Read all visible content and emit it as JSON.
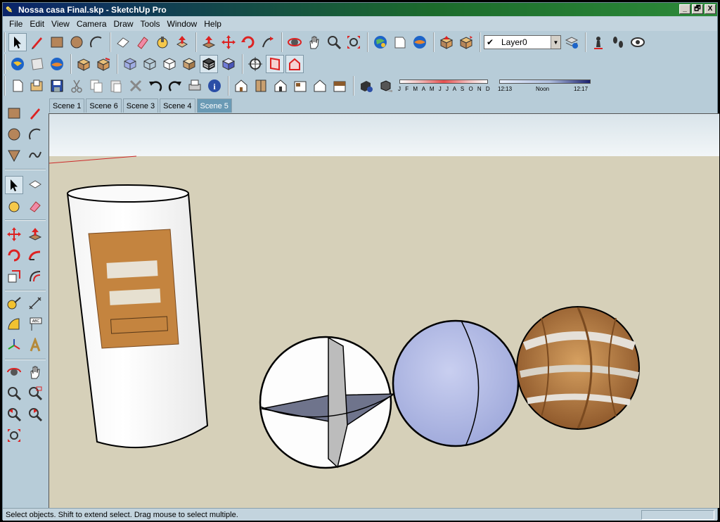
{
  "window": {
    "title": "Nossa casa Final.skp - SketchUp Pro",
    "controls": {
      "minimize": "_",
      "restore": "🗗",
      "close": "X"
    }
  },
  "menu": [
    "File",
    "Edit",
    "View",
    "Camera",
    "Draw",
    "Tools",
    "Window",
    "Help"
  ],
  "layer": {
    "current": "Layer0"
  },
  "shadow_settings": {
    "months_label": "J F M A M J J A S O N D",
    "time_start": "12:13",
    "time_mid": "Noon",
    "time_end": "12:17"
  },
  "scenes": {
    "tabs": [
      "Scene 1",
      "Scene 6",
      "Scene 3",
      "Scene 4",
      "Scene 5"
    ],
    "active_index": 4
  },
  "toolbar_icons": {
    "row1": [
      "select-icon",
      "pencil-icon",
      "rectangle-icon",
      "circle-icon",
      "arc-icon",
      "eraser-icon",
      "tape-measure-icon",
      "paint-bucket-icon",
      "push-pull-icon",
      "move-icon",
      "rotate-icon",
      "follow-me-icon",
      "orbit-icon",
      "pan-icon",
      "zoom-icon",
      "zoom-extents-icon",
      "get-models-icon",
      "share-model-icon",
      "google-earth-icon",
      "make-component-icon",
      "explode-icon"
    ],
    "row2": [
      "earth-snapshot-icon",
      "terrain-icon",
      "earth-toggle-icon",
      "component-icon",
      "group-icon",
      "xray-icon",
      "wireframe-icon",
      "hidden-line-icon",
      "shaded-icon",
      "shaded-textures-icon",
      "monochrome-icon",
      "position-camera-icon",
      "section-plane-icon",
      "section-cut-icon"
    ],
    "row3": [
      "new-file-icon",
      "open-file-icon",
      "save-icon",
      "cut-icon",
      "copy-icon",
      "paste-icon",
      "delete-icon",
      "undo-icon",
      "redo-icon",
      "print-icon",
      "model-info-icon",
      "iso-view-icon",
      "top-view-icon",
      "front-view-icon",
      "right-view-icon",
      "back-view-icon",
      "left-view-icon",
      "shadow-settings-icon",
      "shadows-toggle-icon"
    ]
  },
  "colors": {
    "window_bg": "#b7ccd8",
    "sky": "#e9f0f3",
    "ground": "#d6d0b9",
    "sphere_blue": "#b4bce6",
    "cylinder": "#ffffff",
    "texture": "#c4843f"
  },
  "status": {
    "text": "Select objects. Shift to extend select. Drag mouse to select multiple.",
    "measurements": ""
  }
}
